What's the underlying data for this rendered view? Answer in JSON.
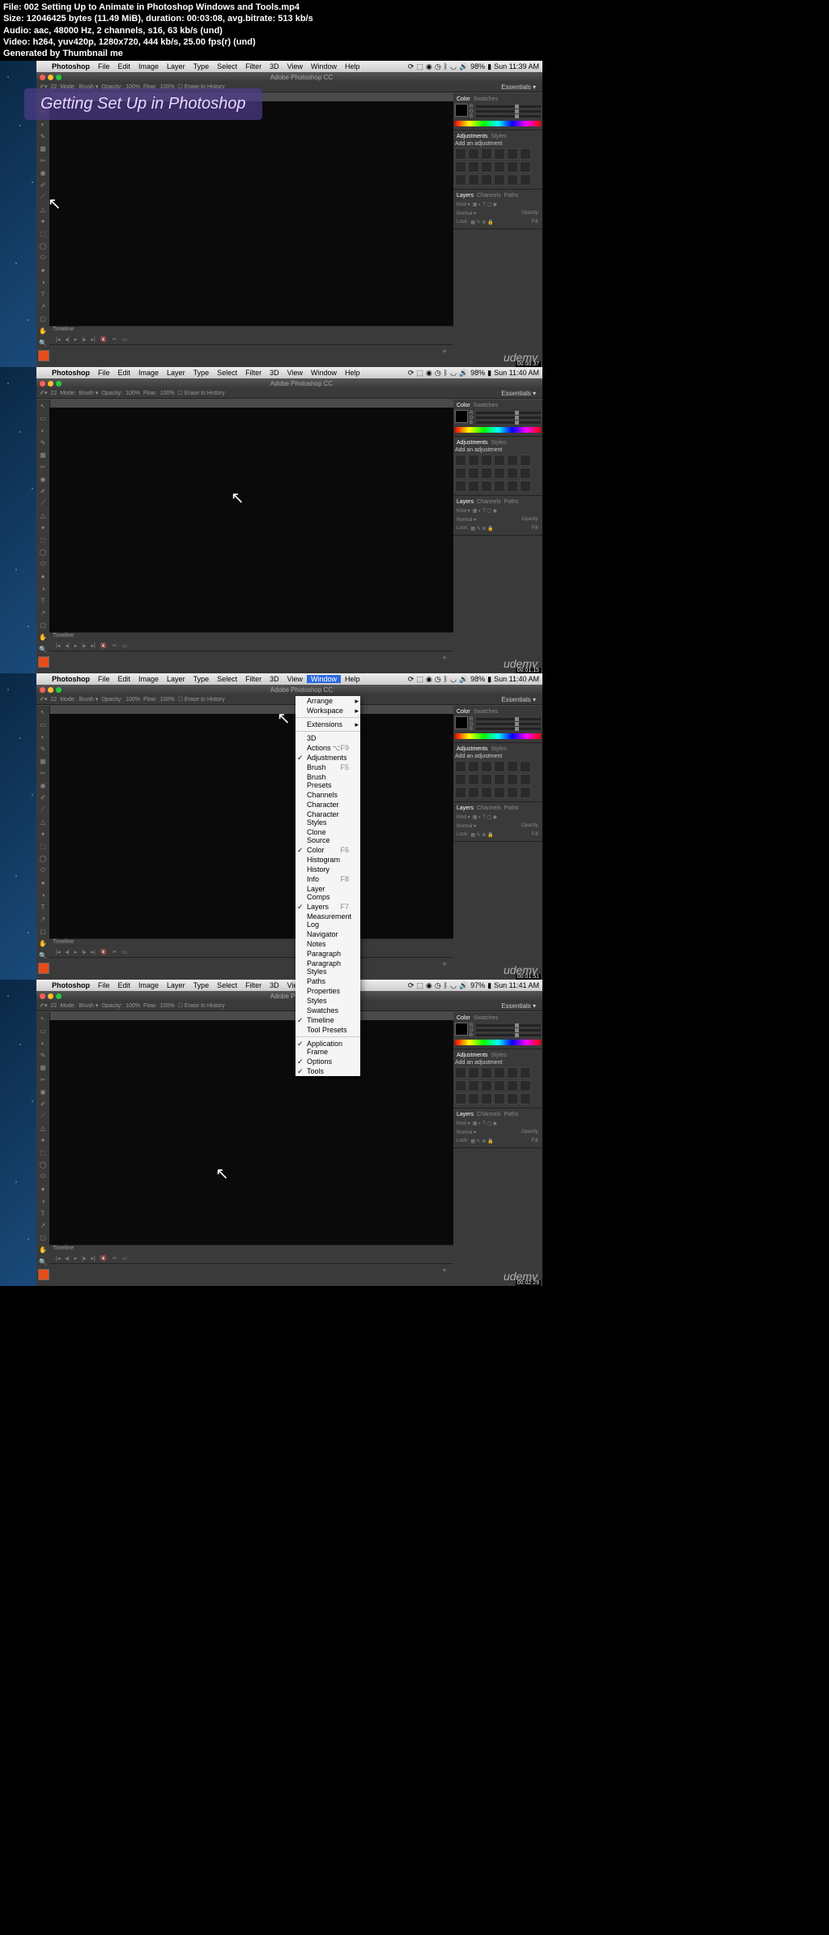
{
  "meta": {
    "file": "File: 002 Setting Up to Animate in Photoshop Windows and Tools.mp4",
    "size": "Size: 12046425 bytes (11.49 MiB), duration: 00:03:08, avg.bitrate: 513 kb/s",
    "audio": "Audio: aac, 48000 Hz, 2 channels, s16, 63 kb/s (und)",
    "video": "Video: h264, yuv420p, 1280x720, 444 kb/s, 25.00 fps(r) (und)",
    "gen": "Generated by Thumbnail me"
  },
  "app": {
    "name": "Photoshop",
    "title": "Adobe Photoshop CC"
  },
  "menu": [
    "File",
    "Edit",
    "Image",
    "Layer",
    "Type",
    "Select",
    "Filter",
    "3D",
    "View",
    "Window",
    "Help"
  ],
  "sysbar": {
    "battery": "98%",
    "day": "Sun"
  },
  "workspace": "Essentials",
  "optbar": {
    "mode": "Mode:",
    "brush": "Brush",
    "opacity": "Opacity:",
    "opval": "100%",
    "flow": "Flow:",
    "flowval": "100%",
    "erase": "Erase to History",
    "size": "22"
  },
  "panels": {
    "color": {
      "tabs": [
        "Color",
        "Swatches"
      ],
      "channels": [
        "R",
        "G",
        "B"
      ]
    },
    "adj": {
      "tabs": [
        "Adjustments",
        "Styles"
      ],
      "label": "Add an adjustment"
    },
    "layers": {
      "tabs": [
        "Layers",
        "Channels",
        "Paths"
      ],
      "kind": "Kind",
      "normal": "Normal",
      "opacity": "Opacity:",
      "lock": "Lock:",
      "fill": "Fill:"
    }
  },
  "timeline": {
    "label": "Timeline"
  },
  "overlay": "Getting Set Up in Photoshop",
  "watermark": "udemy",
  "windowMenu": {
    "top": [
      "Arrange",
      "Workspace"
    ],
    "ext": "Extensions",
    "items": [
      {
        "l": "3D"
      },
      {
        "l": "Actions",
        "s": "⌥F9"
      },
      {
        "l": "Adjustments",
        "c": true
      },
      {
        "l": "Brush",
        "s": "F5"
      },
      {
        "l": "Brush Presets"
      },
      {
        "l": "Channels"
      },
      {
        "l": "Character"
      },
      {
        "l": "Character Styles"
      },
      {
        "l": "Clone Source"
      },
      {
        "l": "Color",
        "c": true,
        "s": "F6"
      },
      {
        "l": "Histogram"
      },
      {
        "l": "History"
      },
      {
        "l": "Info",
        "s": "F8"
      },
      {
        "l": "Layer Comps"
      },
      {
        "l": "Layers",
        "c": true,
        "s": "F7"
      },
      {
        "l": "Measurement Log"
      },
      {
        "l": "Navigator"
      },
      {
        "l": "Notes"
      },
      {
        "l": "Paragraph"
      },
      {
        "l": "Paragraph Styles"
      },
      {
        "l": "Paths"
      },
      {
        "l": "Properties"
      },
      {
        "l": "Styles"
      },
      {
        "l": "Swatches"
      },
      {
        "l": "Timeline",
        "c": true
      },
      {
        "l": "Tool Presets"
      }
    ],
    "bottom": [
      {
        "l": "Application Frame",
        "c": true
      },
      {
        "l": "Options",
        "c": true
      },
      {
        "l": "Tools",
        "c": true
      }
    ]
  },
  "frames": [
    {
      "time": "11:39 AM",
      "tc": "00:00:37",
      "overlay": true,
      "cursor": [
        14,
        150
      ],
      "battery": "98%"
    },
    {
      "time": "11:40 AM",
      "tc": "00:01:15",
      "cursor": [
        240,
        135
      ],
      "battery": "98%"
    },
    {
      "time": "11:40 AM",
      "tc": "00:01:51",
      "menu": true,
      "cursor": [
        297,
        29
      ],
      "battery": "98%"
    },
    {
      "time": "11:41 AM",
      "tc": "00:02:29",
      "cursor": [
        221,
        213
      ],
      "battery": "97%"
    }
  ]
}
